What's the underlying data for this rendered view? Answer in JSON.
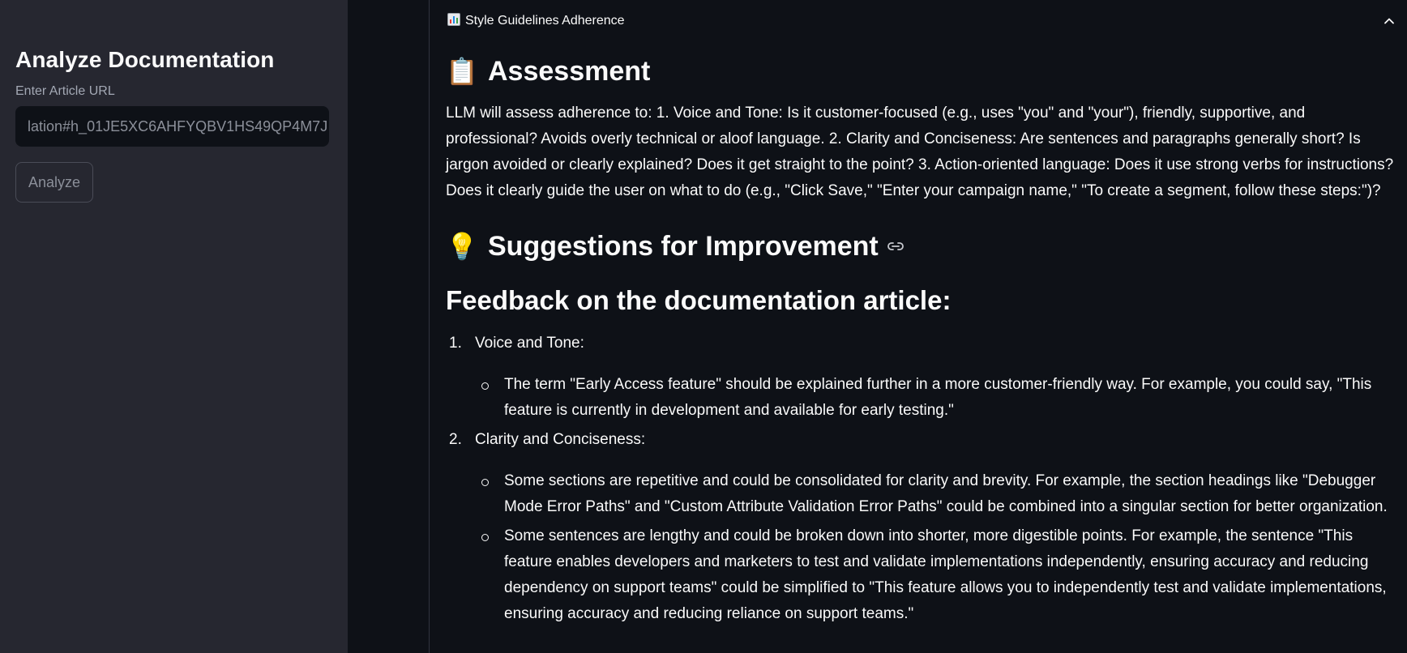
{
  "sidebar": {
    "title": "Analyze Documentation",
    "url_label": "Enter Article URL",
    "url_value": "lation#h_01JE5XC6AHFYQBV1HS49QP4M7J",
    "analyze_button": "Analyze"
  },
  "expander": {
    "icon": "bar-chart-icon",
    "title": "Style Guidelines Adherence"
  },
  "assessment": {
    "emoji": "📋",
    "heading": "Assessment",
    "text": "LLM will assess adherence to: 1. Voice and Tone: Is it customer-focused (e.g., uses \"you\" and \"your\"), friendly, supportive, and professional? Avoids overly technical or aloof language. 2. Clarity and Conciseness: Are sentences and paragraphs generally short? Is jargon avoided or clearly explained? Does it get straight to the point? 3. Action-oriented language: Does it use strong verbs for instructions? Does it clearly guide the user on what to do (e.g., \"Click Save,\" \"Enter your campaign name,\" \"To create a segment, follow these steps:\")?"
  },
  "suggestions": {
    "emoji": "💡",
    "heading": "Suggestions for Improvement",
    "feedback_heading": "Feedback on the documentation article:",
    "items": [
      {
        "num": "1.",
        "title": "Voice and Tone:",
        "subs": [
          "The term \"Early Access feature\" should be explained further in a more customer-friendly way. For example, you could say, \"This feature is currently in development and available for early testing.\""
        ]
      },
      {
        "num": "2.",
        "title": "Clarity and Conciseness:",
        "subs": [
          "Some sections are repetitive and could be consolidated for clarity and brevity. For example, the section headings like \"Debugger Mode Error Paths\" and \"Custom Attribute Validation Error Paths\" could be combined into a singular section for better organization.",
          "Some sentences are lengthy and could be broken down into shorter, more digestible points. For example, the sentence \"This feature enables developers and marketers to test and validate implementations independently, ensuring accuracy and reducing dependency on support teams\" could be simplified to \"This feature allows you to independently test and validate implementations, ensuring accuracy and reducing reliance on support teams.\""
        ]
      }
    ]
  }
}
